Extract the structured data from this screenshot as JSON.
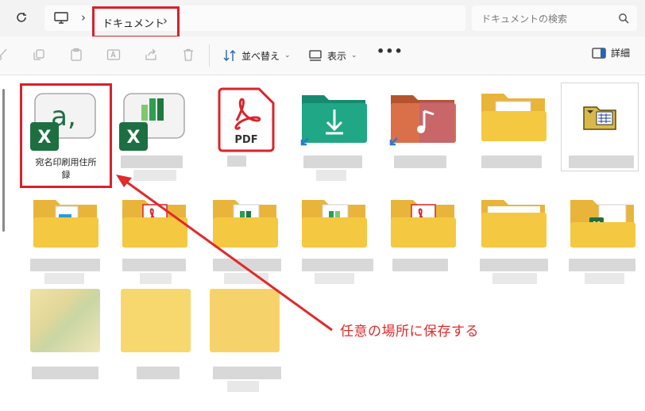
{
  "address_bar": {
    "folder": "ドキュメント"
  },
  "search": {
    "placeholder": "ドキュメントの検索"
  },
  "toolbar": {
    "sort_label": "並べ替え",
    "view_label": "表示",
    "more_label": "•••",
    "details_label": "詳細"
  },
  "selected_file": {
    "name": "宛名印刷用住所録"
  },
  "file_tiles": [
    {
      "kind": "excel-file"
    },
    {
      "kind": "excel-file"
    },
    {
      "kind": "pdf-file",
      "badge": "PDF"
    },
    {
      "kind": "downloads-folder"
    },
    {
      "kind": "music-folder"
    },
    {
      "kind": "folder"
    },
    {
      "kind": "legacy-folder"
    }
  ],
  "annotation": {
    "text": "任意の場所に保存する",
    "color": "#e12a2a"
  },
  "colors": {
    "highlight": "#d9202b",
    "excel_green": "#1d6f42",
    "pdf_red": "#d9252b",
    "folder_yellow": "#f5c842"
  }
}
